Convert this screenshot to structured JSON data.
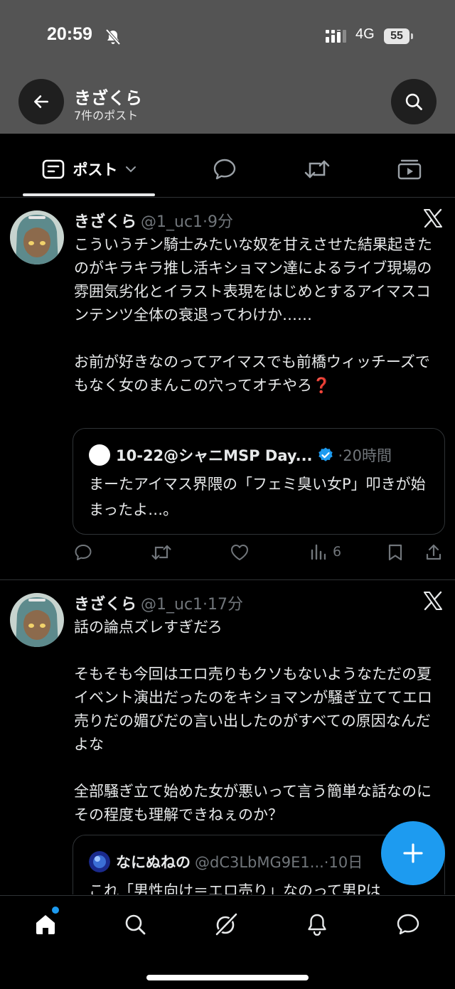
{
  "status_bar": {
    "time": "20:59",
    "network": "4G",
    "battery": "55"
  },
  "header": {
    "name": "きざくら",
    "post_count": "7件のポスト"
  },
  "tabs": {
    "posts_label": "ポスト"
  },
  "posts": [
    {
      "name": "きざくら",
      "meta": "@1_uc1·9分",
      "body": [
        "こういうチン騎士みたいな奴を甘えさせた結果起きたのがキラキラ推し活キショマン達によるライブ現場の雰囲気劣化とイラスト表現をはじめとするアイマスコンテンツ全体の衰退ってわけか……",
        "お前が好きなのってアイマスでも前橋ウィッチーズでもなく女のまんこの穴ってオチやろ❓"
      ],
      "quote": {
        "name": "10-22@シャニMSP Day...",
        "meta": "·20時間",
        "body": "まーたアイマス界隈の「フェミ臭い女P」叩きが始まったよ…。"
      },
      "views": "6"
    },
    {
      "name": "きざくら",
      "meta": "@1_uc1·17分",
      "body": [
        "話の論点ズレすぎだろ",
        "そもそも今回はエロ売りもクソもないようなただの夏イベント演出だったのをキショマンが騒ぎ立ててエロ売りだの媚びだの言い出したのがすべての原因なんだよな",
        "全部騒ぎ立て始めた女が悪いって言う簡単な話なのにその程度も理解できねぇのか？"
      ],
      "quote": {
        "name": "なにぬねの",
        "meta": "@dC3LbMG9E1...·10日",
        "body": "これ「男性向け＝エロ売り」なのって男Pは"
      }
    }
  ],
  "colors": {
    "accent": "#1d9bf0",
    "header_bg": "#545454",
    "muted": "#71767b",
    "divider": "#2f3336"
  }
}
